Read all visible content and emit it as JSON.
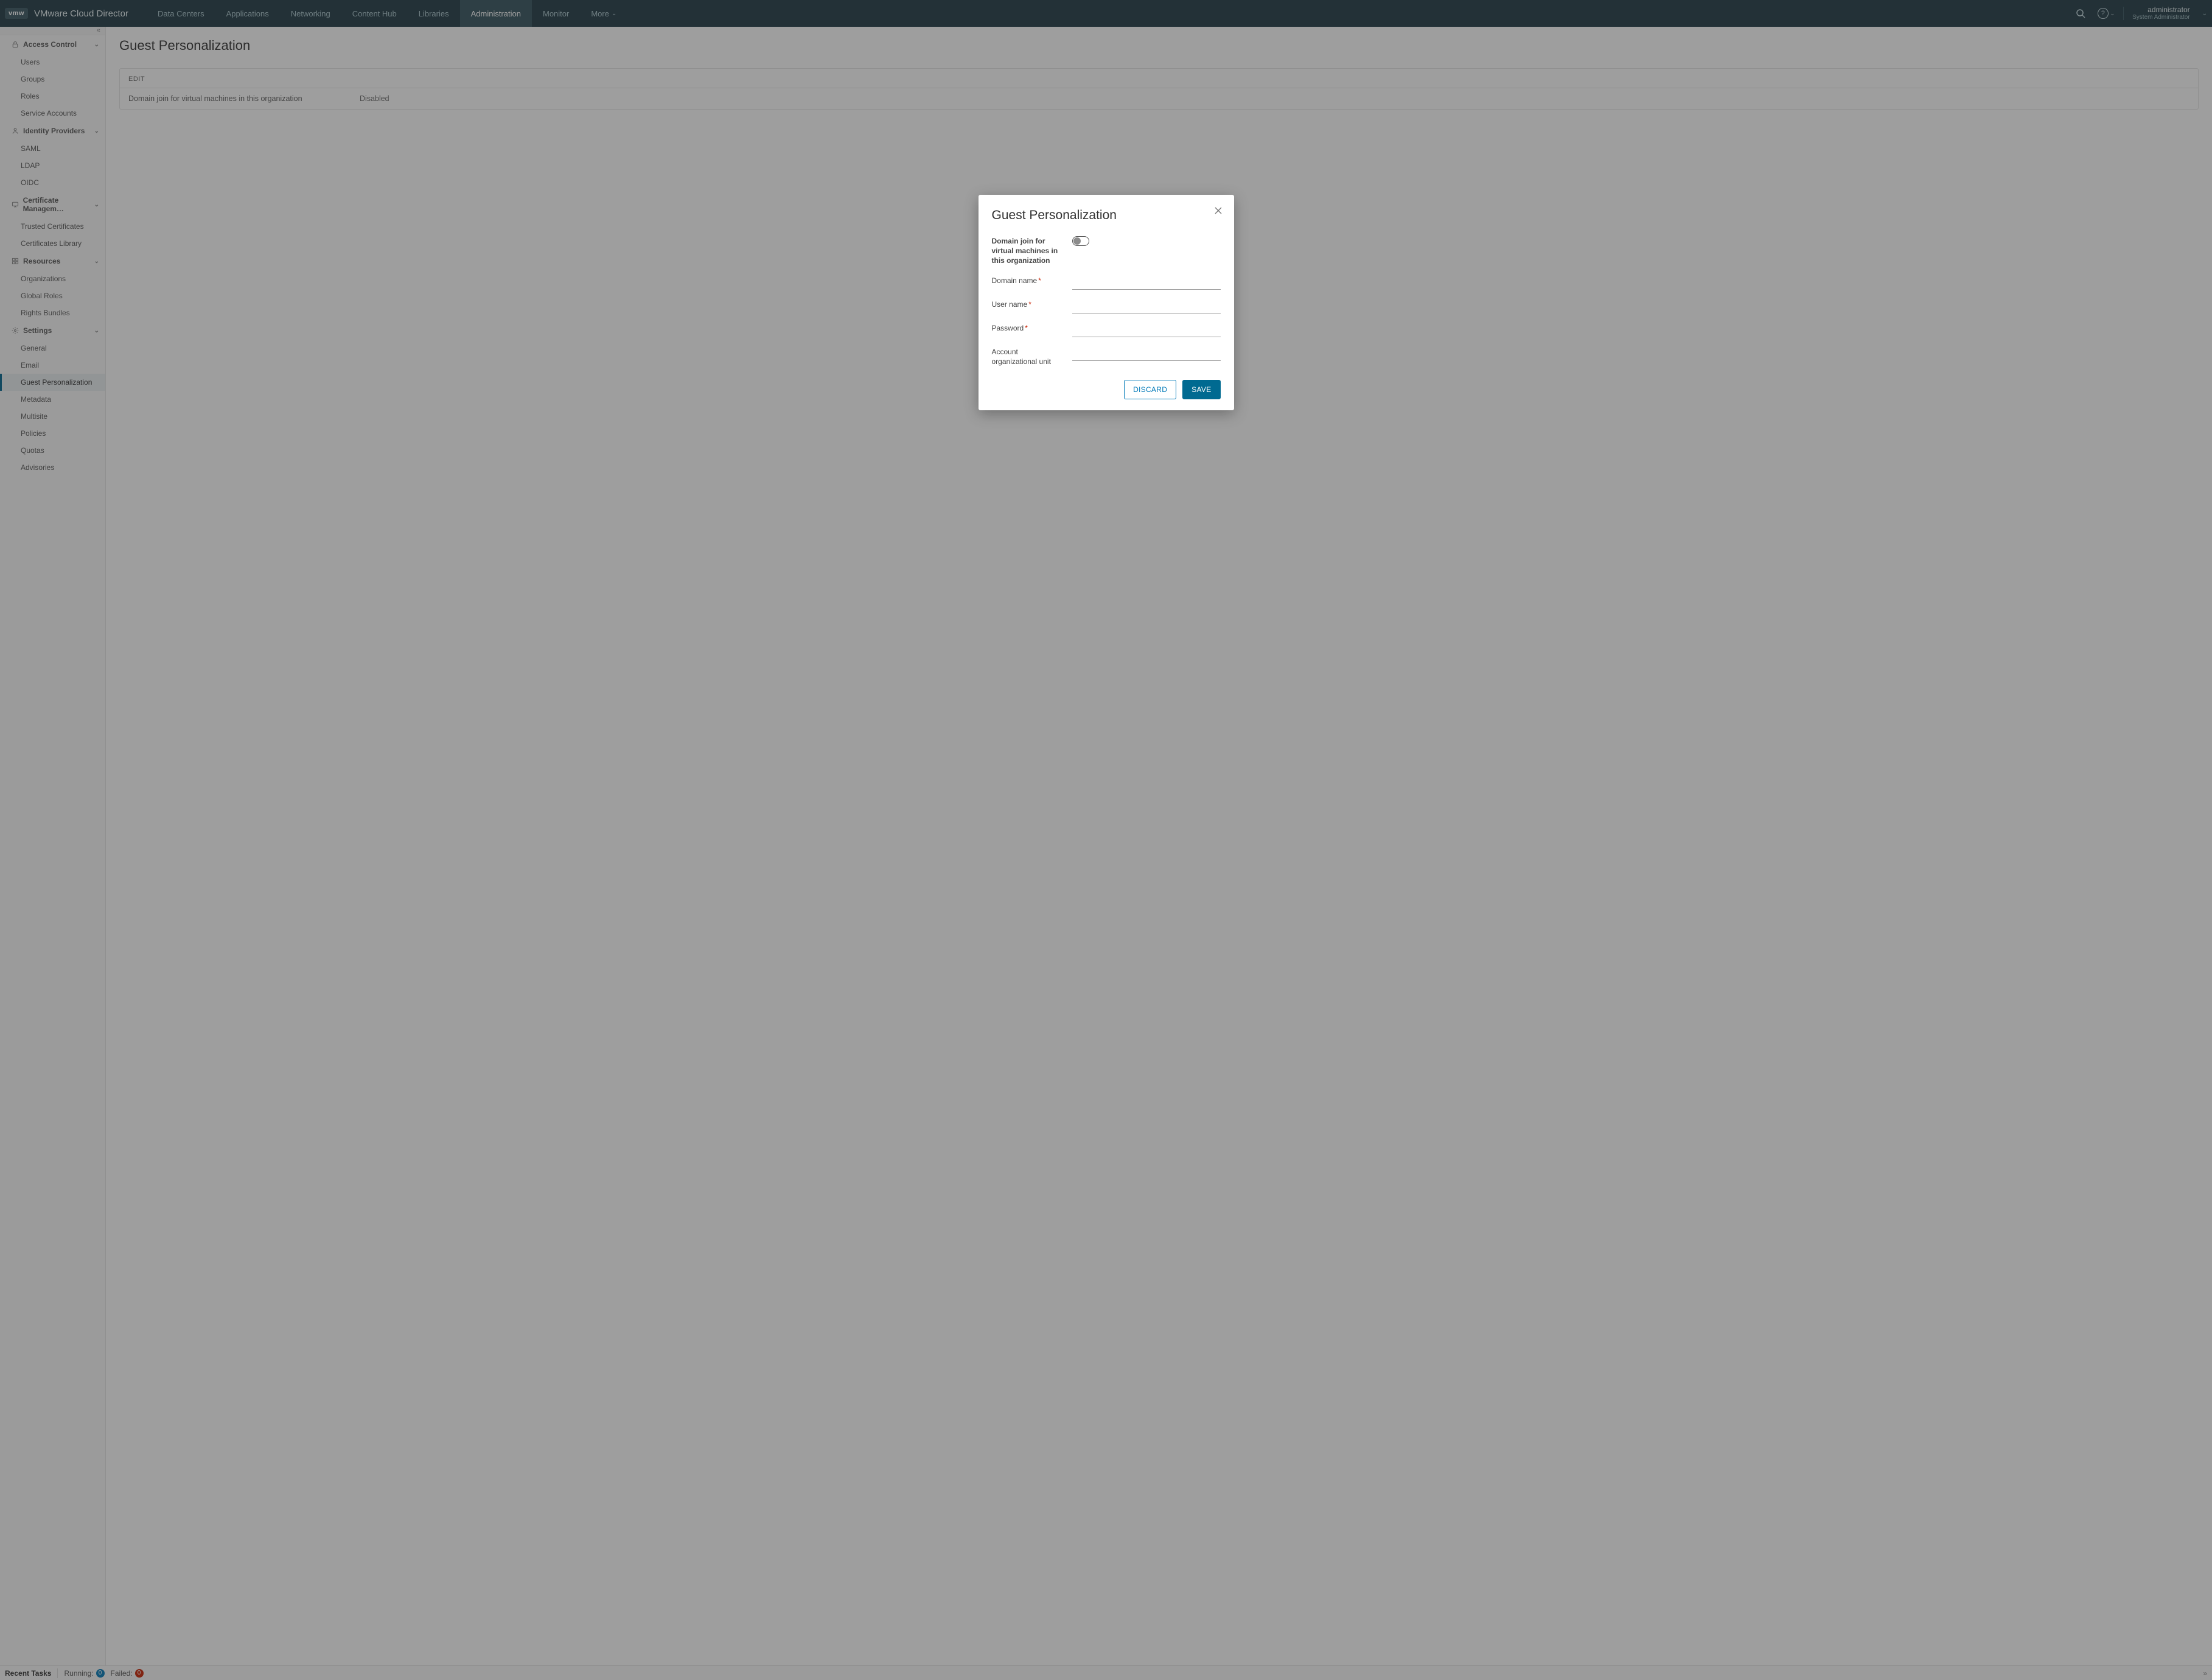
{
  "brand": {
    "chip": "vmw",
    "name": "VMware Cloud Director"
  },
  "nav": {
    "tabs": [
      {
        "label": "Data Centers"
      },
      {
        "label": "Applications"
      },
      {
        "label": "Networking"
      },
      {
        "label": "Content Hub"
      },
      {
        "label": "Libraries"
      },
      {
        "label": "Administration",
        "active": true
      },
      {
        "label": "Monitor"
      },
      {
        "label": "More"
      }
    ]
  },
  "user": {
    "name": "administrator",
    "role": "System Administrator"
  },
  "sidebar": {
    "groups": [
      {
        "label": "Access Control",
        "icon": "lock-icon",
        "items": [
          "Users",
          "Groups",
          "Roles",
          "Service Accounts"
        ]
      },
      {
        "label": "Identity Providers",
        "icon": "id-icon",
        "items": [
          "SAML",
          "LDAP",
          "OIDC"
        ]
      },
      {
        "label": "Certificate Managem…",
        "icon": "cert-icon",
        "items": [
          "Trusted Certificates",
          "Certificates Library"
        ]
      },
      {
        "label": "Resources",
        "icon": "resource-icon",
        "items": [
          "Organizations",
          "Global Roles",
          "Rights Bundles"
        ]
      },
      {
        "label": "Settings",
        "icon": "gear-icon",
        "items": [
          "General",
          "Email",
          "Guest Personalization",
          "Metadata",
          "Multisite",
          "Policies",
          "Quotas",
          "Advisories"
        ],
        "activeItem": 2
      }
    ]
  },
  "page": {
    "title": "Guest Personalization",
    "editLabel": "EDIT",
    "row": {
      "k": "Domain join for virtual machines in this organization",
      "v": "Disabled"
    }
  },
  "modal": {
    "title": "Guest Personalization",
    "toggleLabel": "Domain join for virtual machines in this organization",
    "toggleState": "off",
    "fields": {
      "domain": {
        "label": "Domain name",
        "required": true
      },
      "user": {
        "label": "User name",
        "required": true
      },
      "password": {
        "label": "Password",
        "required": true
      },
      "ou": {
        "label": "Account organizational unit",
        "required": false
      }
    },
    "buttons": {
      "discard": "DISCARD",
      "save": "SAVE"
    }
  },
  "footer": {
    "label": "Recent Tasks",
    "running": {
      "label": "Running:",
      "count": "0"
    },
    "failed": {
      "label": "Failed:",
      "count": "0"
    }
  }
}
